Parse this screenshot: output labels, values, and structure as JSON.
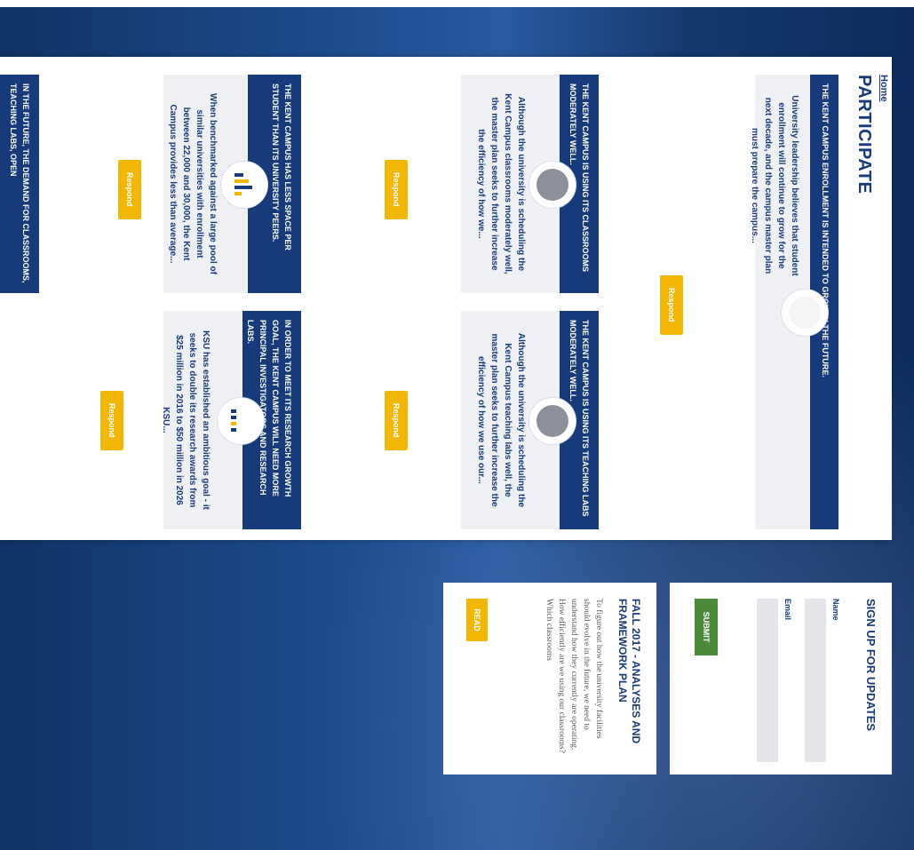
{
  "breadcrumb": {
    "home": "Home"
  },
  "page_title": "PARTICIPATE",
  "hero": {
    "heading": "THE KENT CAMPUS ENROLLMENT IS INTENDED TO GROW IN THE FUTURE.",
    "body": "University leadership believes that student enrollment will continue to grow for the next decade, and the campus master plan must prepare the campus...",
    "button": "Respond"
  },
  "cards": [
    {
      "heading": "THE KENT CAMPUS IS USING ITS CLASSROOMS MODERATELY WELL.",
      "body": "Although the university is scheduling the Kent Campus classrooms moderately well, the master plan seeks to further increase the efficiency of how we...",
      "button": "Respond",
      "icon": "photo-icon"
    },
    {
      "heading": "THE KENT CAMPUS IS USING ITS TEACHING LABS MODERATELY WELL.",
      "body": "Although the university is scheduling the Kent Campus teaching labs well, the master plan seeks to further increase the efficiency of how we use our...",
      "button": "Respond",
      "icon": "photo-icon"
    },
    {
      "heading": "THE KENT CAMPUS HAS LESS SPACE PER STUDENT THAN ITS UNIVERSITY PEERS.",
      "body": "When benchmarked against a large pool of similar universities with enrollment between 22,000 and 30,000, the Kent Campus provides less than average...",
      "button": "Respond",
      "icon": "bar-chart-icon"
    },
    {
      "heading": "IN ORDER TO MEET ITS RESEARCH GROWTH GOAL, THE KENT CAMPUS WILL NEED MORE PRINCIPAL INVESTIGATORS AND RESEARCH LABS.",
      "body": "KSU has established an ambitious goal - it seeks to double its research awards from $25 million in 2016 to $50 million in 2026 KSU...",
      "button": "Respond",
      "icon": "dot-chart-icon"
    },
    {
      "heading": "IN THE FUTURE, THE DEMAND FOR CLASSROOMS, TEACHING LABS, OPEN"
    }
  ],
  "signup": {
    "title": "SIGN UP FOR UPDATES",
    "name_label": "Name",
    "email_label": "Email",
    "submit": "SUBMIT"
  },
  "article": {
    "title": "FALL 2017 - ANALYSES AND FRAMEWORK PLAN",
    "body": "To figure out how the university facilities should evolve in the future, we need to understand how they currently are operating. How efficiently are we using our classrooms? Which classrooms",
    "button": "READ"
  },
  "colors": {
    "navy": "#173b7a",
    "gold": "#f2b705",
    "green": "#4b8b3b"
  }
}
